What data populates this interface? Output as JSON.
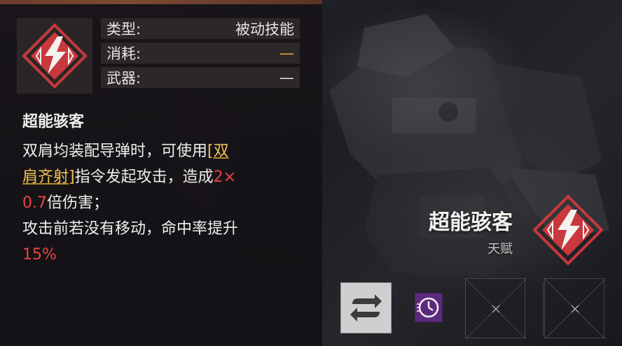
{
  "skill": {
    "icon_name": "lightning-diamond-icon",
    "stats": [
      {
        "label": "类型:",
        "value": "被动技能"
      },
      {
        "label": "消耗:",
        "value": "—"
      },
      {
        "label": "武器:",
        "value": "—"
      }
    ],
    "name": "超能骇客",
    "description": {
      "p1_a": "双肩均装配导弹时，可使用",
      "p1_link_1": "[双",
      "p1_link_2": "肩齐射]",
      "p1_b": "指令发起攻击，造成",
      "p1_num_1": "2×",
      "p1_num_2": "0.7",
      "p1_c": "倍伤害；",
      "p2_a": "攻击前若没有移动，命中率提升",
      "p2_num": "15%"
    }
  },
  "talent": {
    "title": "超能骇客",
    "subtitle": "天赋",
    "icon_name": "lightning-diamond-icon"
  },
  "slots": [
    {
      "icon": "swap-arrows-icon"
    },
    {
      "icon": "clock-ring-icon"
    },
    {
      "icon": "empty-slot-icon"
    },
    {
      "icon": "empty-slot-icon"
    }
  ],
  "colors": {
    "accent_red": "#c8383c",
    "highlight_gold": "#efc15a",
    "number_red": "#e84444",
    "slot_purple": "#5b2a7c"
  }
}
